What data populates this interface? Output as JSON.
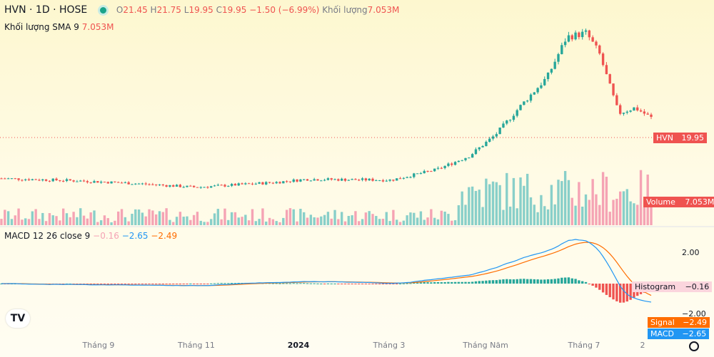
{
  "header": {
    "symbol": "HVN · 1D · HOSE",
    "open_key": "O",
    "open": "21.45",
    "high_key": "H",
    "high": "21.75",
    "low_key": "L",
    "low": "19.95",
    "close_key": "C",
    "close": "19.95",
    "change": "−1.50 (−6.99%)",
    "volume_key": "Khối lượng",
    "volume": "7.053M"
  },
  "volume_sma": {
    "label": "Khối lượng SMA 9",
    "value": "7.053M"
  },
  "macd_legend": {
    "label": "MACD 12 26 close 9",
    "histogram": "−0.16",
    "macd": "−2.65",
    "signal": "−2.49"
  },
  "price_tag": {
    "symbol": "HVN",
    "value": "19.95"
  },
  "volume_tag": {
    "label": "Volume",
    "value": "7.053M"
  },
  "macd_tags": {
    "histogram_label": "Histogram",
    "histogram_value": "−0.16",
    "signal_label": "Signal",
    "signal_value": "−2.49",
    "macd_label": "MACD",
    "macd_value": "−2.65"
  },
  "macd_axis": [
    "2.00",
    "−2.00"
  ],
  "x_axis": [
    "Tháng 9",
    "Tháng 11",
    "2024",
    "Tháng 3",
    "Tháng Năm",
    "Tháng 7",
    "2"
  ],
  "colors": {
    "up": "#26a69a",
    "down": "#ef5350",
    "macd": "#2196f3",
    "signal": "#ff6d00",
    "up_vol": "#88cfc9",
    "down_vol": "#f5a3b4"
  },
  "chart_data": [
    {
      "type": "candlestick",
      "title": "HVN · 1D · HOSE",
      "x": [
        "Tháng 9",
        "Tháng 11",
        "2024",
        "Tháng 3",
        "Tháng Năm",
        "Tháng 7",
        "2"
      ],
      "close": [
        12.2,
        11.4,
        11.8,
        12.0,
        17.5,
        30.0,
        19.95
      ],
      "last": {
        "open": 21.45,
        "high": 21.75,
        "low": 19.95,
        "close": 19.95,
        "change": -1.5,
        "change_pct": -6.99
      }
    },
    {
      "type": "bar",
      "title": "Khối lượng SMA 9",
      "last_volume": "7.053M"
    },
    {
      "type": "line",
      "title": "MACD 12 26 close 9",
      "series": [
        {
          "name": "MACD",
          "last": -2.65
        },
        {
          "name": "Signal",
          "last": -2.49
        },
        {
          "name": "Histogram",
          "last": -0.16
        }
      ],
      "y_ticks": [
        2.0,
        -2.0
      ]
    }
  ]
}
